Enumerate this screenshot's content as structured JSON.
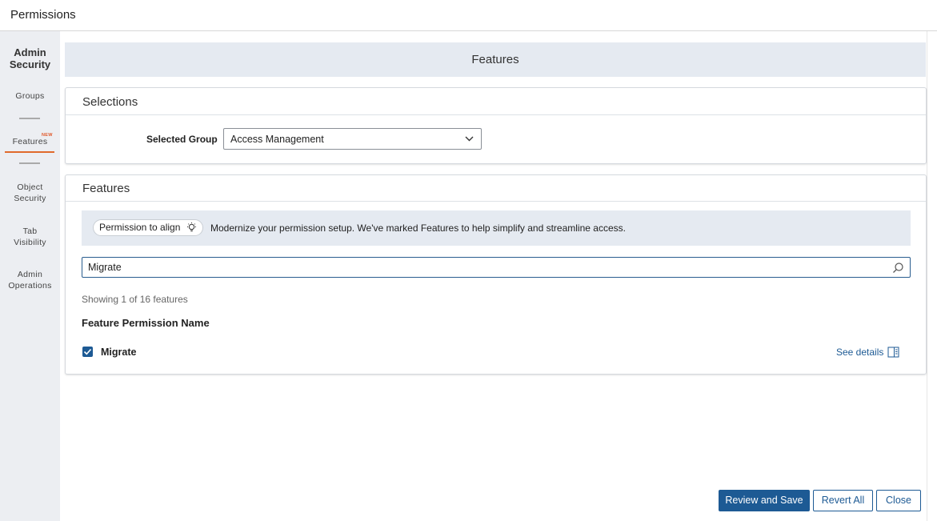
{
  "window": {
    "title": "Permissions"
  },
  "sidebar": {
    "heading_line1": "Admin",
    "heading_line2": "Security",
    "items": [
      {
        "label": "Groups"
      },
      {
        "label": "Features",
        "badge": "NEW",
        "active": true
      },
      {
        "label_line1": "Object",
        "label_line2": "Security"
      },
      {
        "label_line1": "Tab",
        "label_line2": "Visibility"
      },
      {
        "label_line1": "Admin",
        "label_line2": "Operations"
      }
    ]
  },
  "main": {
    "header_title": "Features",
    "selections": {
      "title": "Selections",
      "group_label": "Selected Group",
      "group_value": "Access Management"
    },
    "features": {
      "title": "Features",
      "banner_pill": "Permission to align",
      "banner_text": "Modernize your permission setup. We've marked Features to help simplify and streamline access.",
      "search_value": "Migrate",
      "showing_text": "Showing 1 of 16 features",
      "column_header": "Feature Permission Name",
      "rows": [
        {
          "name": "Migrate",
          "checked": true,
          "details_label": "See details"
        }
      ]
    }
  },
  "footer": {
    "review_label": "Review and Save",
    "revert_label": "Revert All",
    "close_label": "Close"
  },
  "colors": {
    "primary": "#1d5a94",
    "accent": "#e06a2c",
    "sidebar_bg": "#eceef2",
    "header_bg": "#e5eaf1"
  }
}
